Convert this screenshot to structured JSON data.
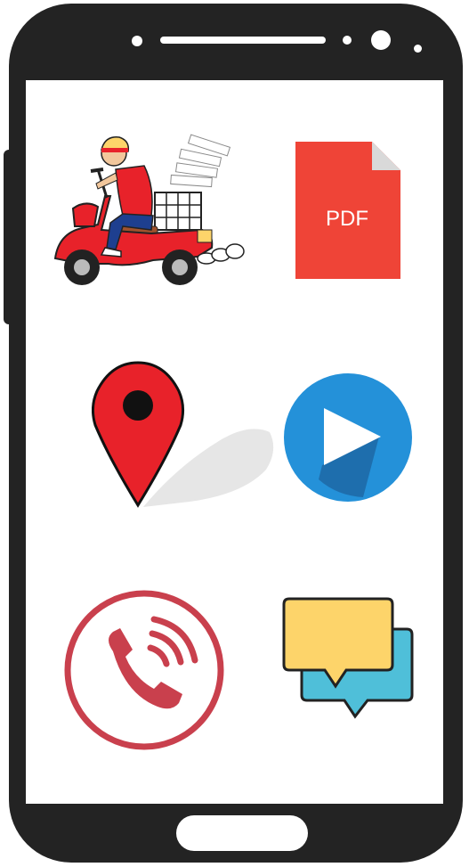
{
  "device": {
    "frame_color": "#232323",
    "screen_color": "#ffffff"
  },
  "apps": [
    {
      "id": "delivery",
      "icon": "delivery-scooter-icon",
      "accent": "#e8222a"
    },
    {
      "id": "pdf",
      "icon": "pdf-file-icon",
      "label": "PDF",
      "accent": "#ef4437"
    },
    {
      "id": "maps",
      "icon": "map-pin-icon",
      "accent": "#e8222a"
    },
    {
      "id": "video",
      "icon": "play-icon",
      "accent": "#2491d9"
    },
    {
      "id": "phone",
      "icon": "phone-call-icon",
      "accent": "#c9404d"
    },
    {
      "id": "chat",
      "icon": "chat-bubbles-icon",
      "accent": "#fdd46a"
    }
  ]
}
